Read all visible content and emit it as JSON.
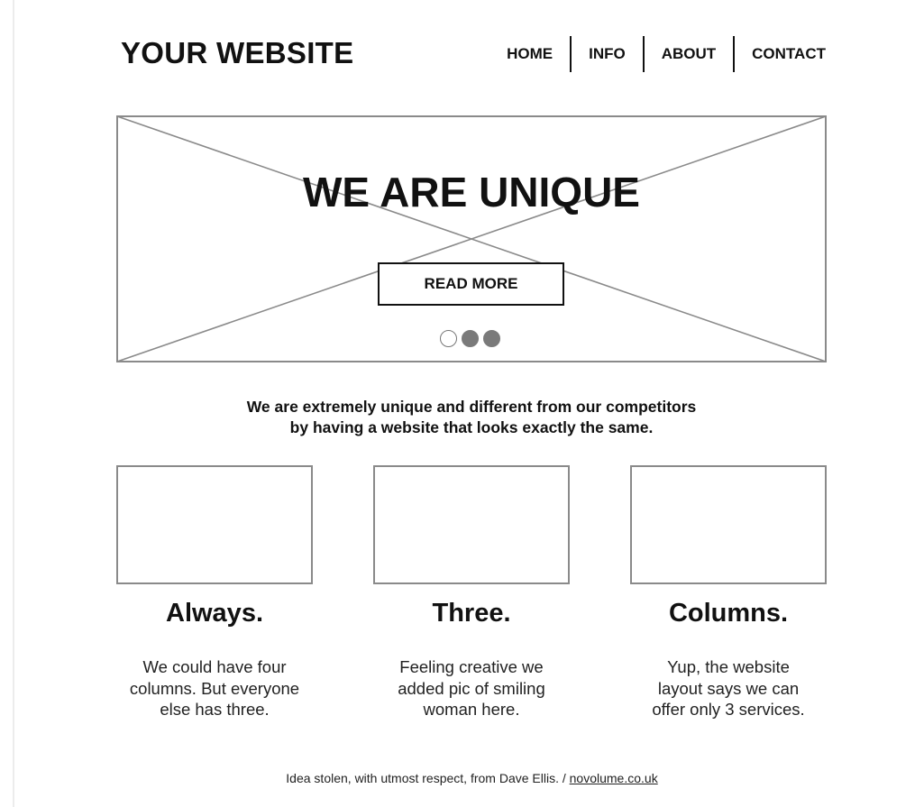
{
  "header": {
    "logo": "YOUR WEBSITE",
    "nav": [
      "HOME",
      "INFO",
      "ABOUT",
      "CONTACT"
    ]
  },
  "hero": {
    "title": "WE ARE UNIQUE",
    "button": "READ MORE",
    "slides": {
      "total": 3,
      "active_indicator": "first dot empty, other two filled"
    }
  },
  "tagline": {
    "line1": "We are extremely unique and different from our competitors",
    "line2": "by having a website that looks exactly the same."
  },
  "columns": [
    {
      "title": "Always.",
      "lines": [
        "We could have four",
        "columns. But everyone",
        "else has three."
      ]
    },
    {
      "title": "Three.",
      "lines": [
        "Feeling creative we",
        "added pic of smiling",
        "woman here."
      ]
    },
    {
      "title": "Columns.",
      "lines": [
        "Yup, the website",
        "layout says we can",
        "offer only 3 services."
      ]
    }
  ],
  "footer": {
    "text": "Idea stolen, with utmost respect, from Dave Ellis. / ",
    "link": "novolume.co.uk"
  },
  "colors": {
    "text": "#111111",
    "wireframe_line": "#8a8a8a",
    "dot_filled": "#7a7a7a",
    "background": "#ffffff"
  }
}
